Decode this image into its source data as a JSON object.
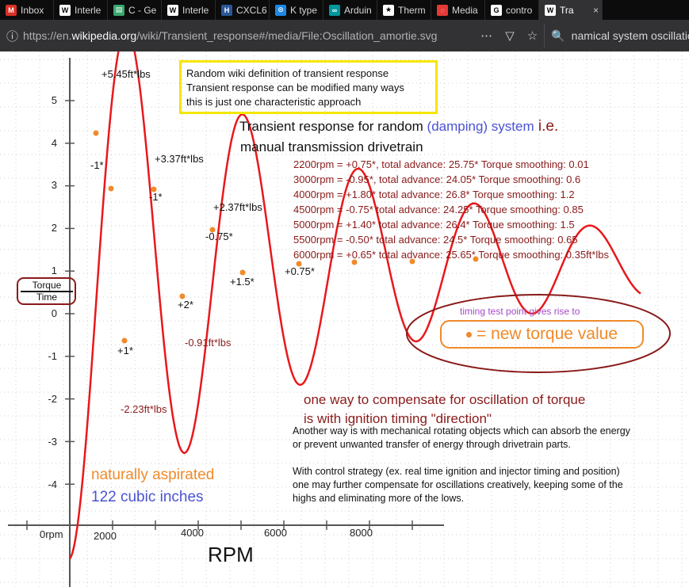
{
  "browser": {
    "tabs": [
      {
        "label": "Inbox",
        "icon": "gmail-icon",
        "color": "#d93025"
      },
      {
        "label": "Interle",
        "icon": "wikipedia-icon",
        "color": "#ffffff"
      },
      {
        "label": "C - Ge",
        "icon": "chart-icon",
        "color": "#3aa76d"
      },
      {
        "label": "Interle",
        "icon": "wikipedia-icon",
        "color": "#ffffff"
      },
      {
        "label": "CXCL6",
        "icon": "hgnc-icon",
        "color": "#2b5797"
      },
      {
        "label": "K type",
        "icon": "kicad-icon",
        "color": "#1e88e5"
      },
      {
        "label": "Arduin",
        "icon": "arduino-icon",
        "color": "#00979d"
      },
      {
        "label": "Therm",
        "icon": "star-icon",
        "color": "#ffffff"
      },
      {
        "label": "Media",
        "icon": "loading-icon",
        "color": "#e53935"
      },
      {
        "label": "contro",
        "icon": "google-icon",
        "color": "#ffffff"
      },
      {
        "label": "Tra",
        "icon": "wikipedia-icon",
        "color": "#ffffff",
        "active": true
      }
    ],
    "url_prefix": "https://en.",
    "url_domain": "wikipedia.org",
    "url_rest": "/wiki/Transient_response#/media/File:Oscillation_amortie.svg",
    "search_value": "namical system oscillation"
  },
  "note_box": [
    "Random wiki definition of transient response",
    "Transient response can be modified many ways",
    "this is just one characteristic approach"
  ],
  "title": {
    "line1_a": "Transient response for random ",
    "line1_damping": "(damping) system",
    "line1_ie": " i.e.",
    "line2": "manual transmission  drivetrain"
  },
  "rpm_settings": [
    "2200rpm = +0.75*, total advance: 25.75* Torque smoothing: 0.01",
    "3000rpm = -0.95*, total advance: 24.05* Torque smoothing: 0.6",
    "4000rpm = +1.80* total advance: 26.8* Torque smoothing: 1.2",
    "4500rpm = -0.75* total advance: 24.25* Torque smoothing: 0.85",
    "5000rpm = +1.40* total advance: 26.4* Torque smoothing: 1.5",
    "5500rpm = -0.50* total advance: 24.5* Torque smoothing: 0.65",
    "6000rpm = +0.65* total advance: 25.65* Torque smoothing: 0.35ft*lbs"
  ],
  "peak_labels": [
    "+5.45ft*lbs",
    "+3.37ft*lbs",
    "+2.37ft*lbs"
  ],
  "trough_labels": [
    "-2.23ft*lbs",
    "-0.91ft*lbs"
  ],
  "timing_labels": [
    "-1*",
    "-1*",
    "-0.75*",
    "+1*",
    "+2*",
    "+1.5*",
    "+0.75*"
  ],
  "y_ticks": [
    "5",
    "4",
    "3",
    "2",
    "1",
    "0",
    "-1",
    "-2",
    "-3",
    "-4"
  ],
  "x_ticks": [
    "0rpm",
    "2000",
    "4000",
    "6000",
    "8000"
  ],
  "x_axis_label": "RPM",
  "y_axis_label": {
    "top": "Torque",
    "bottom": "Time"
  },
  "legend": {
    "caption": "timing test point gives rise to",
    "text": "= new torque value",
    "dot_color": "#f08a2a"
  },
  "compensate": [
    "one way to compensate for oscillation of torque",
    "is with ignition timing \"direction\""
  ],
  "another_way": [
    "Another way is with mechanical rotating objects which can absorb the energy",
    "or prevent unwanted transfer of energy through drivetrain parts.",
    "",
    "With control strategy (ex. real time ignition and injector timing and position)",
    "one may further compensate for oscillations creatively, keeping some of the",
    "highs and eliminating more of the lows."
  ],
  "engine": {
    "line1": "naturally aspirated",
    "line2": "122 cubic inches"
  },
  "colors": {
    "curve": "#e8181c",
    "accent_dark_red": "#8a1a1a",
    "orange": "#f08a2a",
    "blue": "#4a53d1"
  }
}
